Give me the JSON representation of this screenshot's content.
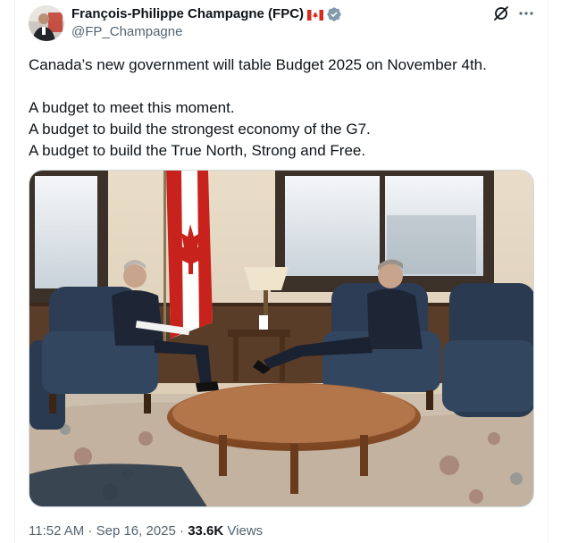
{
  "author": {
    "display_name": "François-Philippe Champagne (FPC)",
    "handle": "@FP_Champagne",
    "flag_icon": "canada-flag-icon",
    "verified_icon": "verified-badge-icon",
    "verified_color": "#829aab"
  },
  "header_actions": {
    "grok_icon": "grok-icon",
    "more_icon": "more-options-icon"
  },
  "tweet": {
    "lines": [
      "Canada’s new government will table Budget 2025 on November 4th.",
      "A budget to meet this moment.",
      "A budget to build the strongest economy of the G7.",
      "A budget to build the True North, Strong and Free."
    ]
  },
  "media": {
    "type": "photo",
    "subject": "meeting-in-office-photo"
  },
  "meta": {
    "time": "11:52 AM",
    "separator": "·",
    "date": "Sep 16, 2025",
    "views_count": "33.6K",
    "views_label": "Views"
  },
  "colors": {
    "text_primary": "#0f1419",
    "text_secondary": "#536471",
    "border": "#cfd9de"
  }
}
